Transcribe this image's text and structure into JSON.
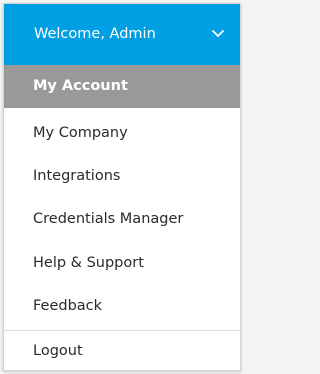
{
  "header": {
    "title": "Welcome, Admin",
    "chevron_icon": "chevron-down-icon",
    "background": "#009fe3"
  },
  "menu": {
    "active_background": "#999999",
    "items": [
      {
        "label": "My Account",
        "active": true
      },
      {
        "label": "My Company"
      },
      {
        "label": "Integrations"
      },
      {
        "label": "Credentials Manager"
      },
      {
        "label": "Help & Support"
      },
      {
        "label": "Feedback"
      },
      {
        "label": "Logout"
      }
    ]
  }
}
